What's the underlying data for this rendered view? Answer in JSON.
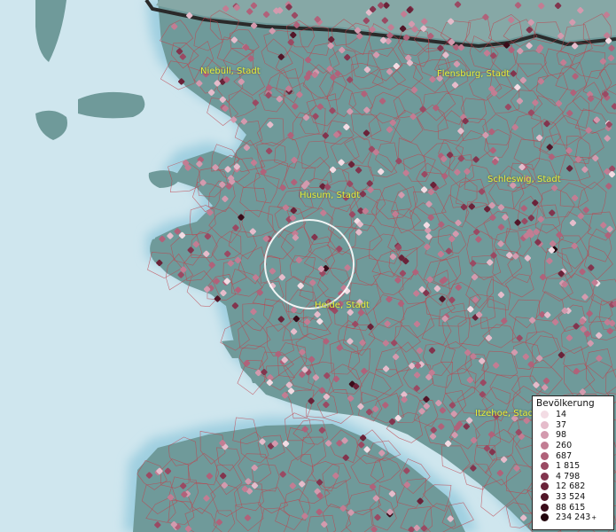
{
  "map": {
    "colors": {
      "sea": "#cfe6ee",
      "shallow": "#b6dbe6",
      "coast_glow": "#9fcfe0",
      "land": "#6f9a9a",
      "land_dark": "#5e8a88",
      "border_line": "#c0424c",
      "frame_line": "#2a2a2a"
    },
    "cities": [
      {
        "name": "Niebüll, Stadt",
        "key": "niebull"
      },
      {
        "name": "Flensburg, Stadt",
        "key": "flensburg"
      },
      {
        "name": "Husum, Stadt",
        "key": "husum"
      },
      {
        "name": "Schleswig, Stadt",
        "key": "schleswig"
      },
      {
        "name": "Heide, Stadt",
        "key": "heide"
      },
      {
        "name": "Itzehoe, Stadt",
        "key": "itzehoe"
      }
    ],
    "selection_circle": {
      "color": "#ffffff"
    }
  },
  "legend": {
    "title": "Bevölkerung",
    "classes": [
      {
        "label": "14",
        "color": "#f3dce4"
      },
      {
        "label": "37",
        "color": "#e5bccb"
      },
      {
        "label": "98",
        "color": "#d39aae"
      },
      {
        "label": "260",
        "color": "#c27d93"
      },
      {
        "label": "687",
        "color": "#b0627a"
      },
      {
        "label": "1 815",
        "color": "#9a4a63"
      },
      {
        "label": "4 798",
        "color": "#82354e"
      },
      {
        "label": "12 682",
        "color": "#6a2339"
      },
      {
        "label": "33 524",
        "color": "#521628"
      },
      {
        "label": "88 615",
        "color": "#3a0c1a"
      },
      {
        "label": "234 243",
        "color": "#22050d",
        "suffix": "+"
      }
    ]
  }
}
